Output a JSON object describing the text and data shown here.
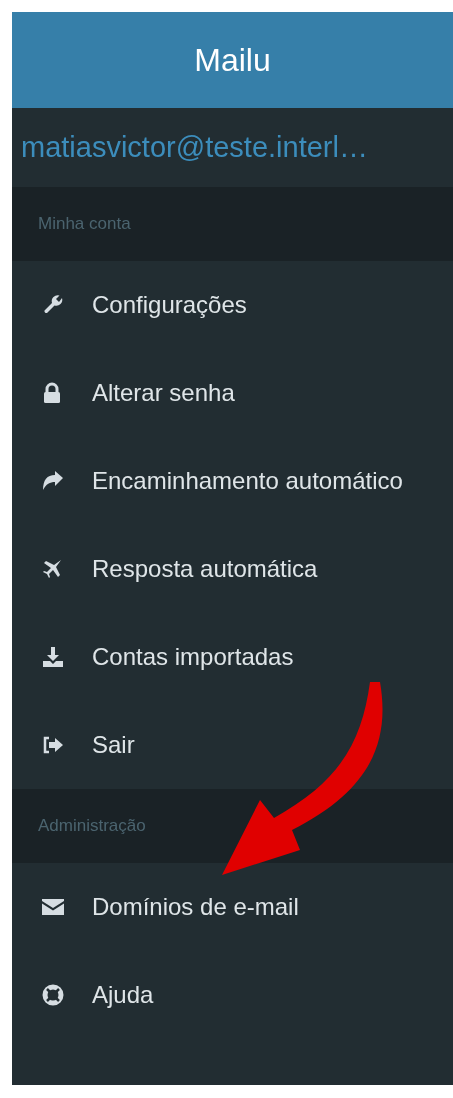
{
  "header": {
    "title": "Mailu"
  },
  "user": {
    "email": "matiasvictor@teste.interl…"
  },
  "sections": [
    {
      "title": "Minha conta",
      "items": [
        {
          "label": "Configurações"
        },
        {
          "label": "Alterar senha"
        },
        {
          "label": "Encaminhamento automático"
        },
        {
          "label": "Resposta automática"
        },
        {
          "label": "Contas importadas"
        },
        {
          "label": "Sair"
        }
      ]
    },
    {
      "title": "Administração",
      "items": [
        {
          "label": "Domínios de e-mail"
        },
        {
          "label": "Ajuda"
        }
      ]
    }
  ]
}
